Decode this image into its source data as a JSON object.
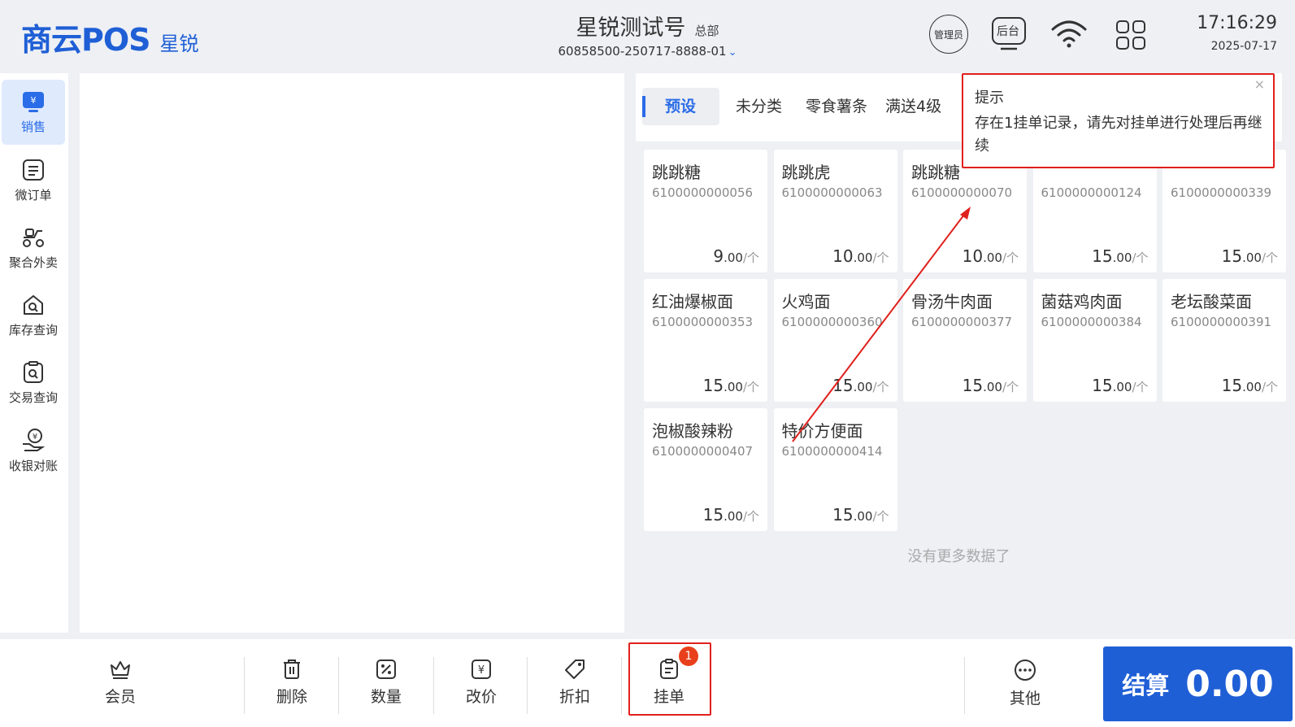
{
  "header": {
    "logo_main": "商云POS",
    "logo_sub": "星锐",
    "store_name": "星锐测试号",
    "store_tag": "总部",
    "store_code": "60858500-250717-8888-01",
    "admin_label": "管理员",
    "backend_label": "后台",
    "time": "17:16:29",
    "date": "2025-07-17"
  },
  "sidebar": {
    "items": [
      {
        "label": "销售",
        "icon": "sales-icon"
      },
      {
        "label": "微订单",
        "icon": "order-icon"
      },
      {
        "label": "聚合外卖",
        "icon": "delivery-icon"
      },
      {
        "label": "库存查询",
        "icon": "inventory-icon"
      },
      {
        "label": "交易查询",
        "icon": "transaction-icon"
      },
      {
        "label": "收银对账",
        "icon": "reconcile-icon"
      }
    ]
  },
  "categories": [
    "预设",
    "未分类",
    "零食薯条",
    "满送4级"
  ],
  "products": [
    {
      "name": "跳跳糖",
      "code": "6100000000056",
      "price_int": "9",
      "price_dec": ".00",
      "unit": "/个"
    },
    {
      "name": "跳跳虎",
      "code": "6100000000063",
      "price_int": "10",
      "price_dec": ".00",
      "unit": "/个"
    },
    {
      "name": "跳跳糖",
      "code": "6100000000070",
      "price_int": "10",
      "price_dec": ".00",
      "unit": "/个"
    },
    {
      "name": "",
      "code": "6100000000124",
      "price_int": "15",
      "price_dec": ".00",
      "unit": "/个"
    },
    {
      "name": "",
      "code": "6100000000339",
      "price_int": "15",
      "price_dec": ".00",
      "unit": "/个"
    },
    {
      "name": "红油爆椒面",
      "code": "6100000000353",
      "price_int": "15",
      "price_dec": ".00",
      "unit": "/个"
    },
    {
      "name": "火鸡面",
      "code": "6100000000360",
      "price_int": "15",
      "price_dec": ".00",
      "unit": "/个"
    },
    {
      "name": "骨汤牛肉面",
      "code": "6100000000377",
      "price_int": "15",
      "price_dec": ".00",
      "unit": "/个"
    },
    {
      "name": "菌菇鸡肉面",
      "code": "6100000000384",
      "price_int": "15",
      "price_dec": ".00",
      "unit": "/个"
    },
    {
      "name": "老坛酸菜面",
      "code": "6100000000391",
      "price_int": "15",
      "price_dec": ".00",
      "unit": "/个"
    },
    {
      "name": "泡椒酸辣粉",
      "code": "6100000000407",
      "price_int": "15",
      "price_dec": ".00",
      "unit": "/个"
    },
    {
      "name": "特价方便面",
      "code": "6100000000414",
      "price_int": "15",
      "price_dec": ".00",
      "unit": "/个"
    }
  ],
  "no_more": "没有更多数据了",
  "toast": {
    "title": "提示",
    "message": "存在1挂单记录，请先对挂单进行处理后再继续",
    "close": "×"
  },
  "bottombar": {
    "member": "会员",
    "delete": "删除",
    "quantity": "数量",
    "change_price": "改价",
    "discount": "折扣",
    "hold_order": "挂单",
    "hold_badge": "1",
    "other": "其他",
    "checkout_label": "结算",
    "checkout_amount": "0.00"
  },
  "colors": {
    "brand": "#1f5fd6",
    "accent": "#2b6ce8",
    "alert_red": "#e0201c"
  }
}
